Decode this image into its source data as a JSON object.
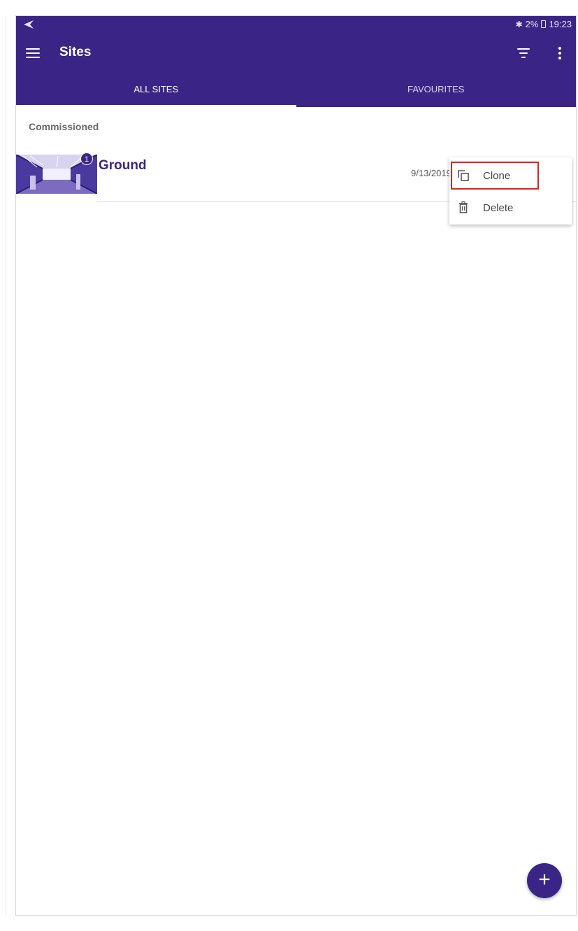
{
  "status_bar": {
    "battery": "2%",
    "time": "19:23",
    "icons": [
      "nav-arrow-icon",
      "bluetooth-icon",
      "battery-icon"
    ]
  },
  "toolbar": {
    "title": "Sites",
    "icons": [
      "menu-icon",
      "filter-icon",
      "more-vert-icon"
    ]
  },
  "tabs": [
    {
      "label": "ALL SITES",
      "selected": true
    },
    {
      "label": "FAVOURITES",
      "selected": false
    }
  ],
  "section": {
    "header": "Commissioned"
  },
  "sites": [
    {
      "name": "Ground",
      "date": "9/13/2019",
      "badge": "1"
    }
  ],
  "context_menu": {
    "items": [
      {
        "label": "Clone",
        "icon": "clone-icon",
        "highlighted": true
      },
      {
        "label": "Delete",
        "icon": "trash-icon"
      }
    ]
  },
  "fab": {
    "label": "+",
    "icon": "add-icon"
  },
  "colors": {
    "primary": "#3a2587",
    "highlight": "#e0201e",
    "background": "#ffffff"
  }
}
